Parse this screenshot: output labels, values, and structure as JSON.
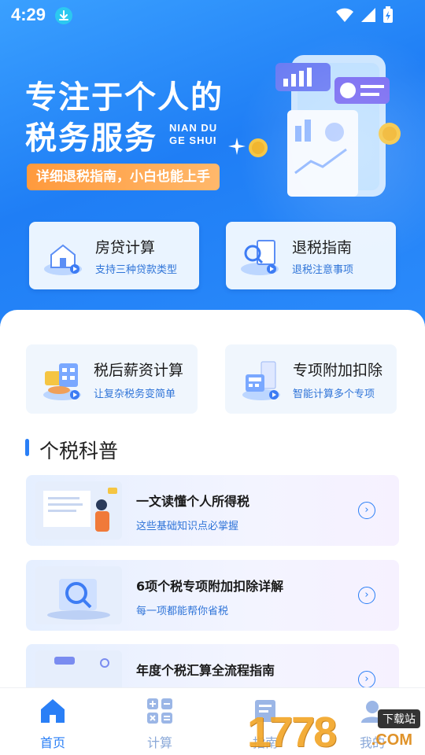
{
  "status_bar": {
    "time": "4:29"
  },
  "hero": {
    "title_line1": "专注于个人的",
    "title_line2": "税务服务",
    "en_line1": "NIAN DU",
    "en_line2": "GE SHUI",
    "pill": "详细退税指南，小白也能上手"
  },
  "quick_cards": [
    {
      "title": "房贷计算",
      "subtitle": "支持三种贷款类型"
    },
    {
      "title": "退税指南",
      "subtitle": "退税注意事项"
    }
  ],
  "tools": [
    {
      "title": "税后薪资计算",
      "subtitle": "让复杂税务变简单"
    },
    {
      "title": "专项附加扣除",
      "subtitle": "智能计算多个专项"
    }
  ],
  "section": {
    "title": "个税科普"
  },
  "articles": [
    {
      "title": "一文读懂个人所得税",
      "subtitle": "这些基础知识点必掌握"
    },
    {
      "title": "6项个税专项附加扣除详解",
      "subtitle": "每一项都能帮你省税"
    },
    {
      "title": "年度个税汇算全流程指南",
      "subtitle": ""
    }
  ],
  "bottom_nav": [
    {
      "label": "首页",
      "icon": "home-icon",
      "active": true
    },
    {
      "label": "计算",
      "icon": "calculator-icon",
      "active": false
    },
    {
      "label": "指南",
      "icon": "book-icon",
      "active": false
    },
    {
      "label": "我的",
      "icon": "profile-icon",
      "active": false
    }
  ],
  "watermark": {
    "number": "1778",
    "domain": ".COM",
    "tag": "下载站"
  },
  "colors": {
    "primary": "#2a7ff6",
    "accent_orange": "#ff9a3d",
    "hero_bg": "#1f7ef5"
  }
}
